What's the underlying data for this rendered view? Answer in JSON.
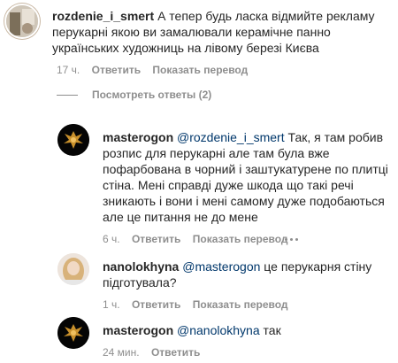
{
  "comments": {
    "top": {
      "username": "rozdenie_i_smert",
      "text": "А тепер будь ласка відмийте рекламу перукарні якою ви замалювали керамічне панно українських художниць на лівому березі Києва",
      "time": "17 ч.",
      "reply_label": "Ответить",
      "translate_label": "Показать перевод"
    },
    "view_replies_label": "Посмотреть ответы (2)",
    "replies": [
      {
        "username": "masterogon",
        "mention": "@rozdenie_i_smert",
        "text": "Так, я там робив розпис для перукарні але там була вже пофарбована в чорний і заштукатурене по плитці стіна. Мені справді дуже шкода що такі речі зникають і вони і мені самому дуже подобаються але це питання не до мене",
        "time": "6 ч.",
        "reply_label": "Ответить",
        "translate_label": "Показать перевод"
      },
      {
        "username": "nanolokhyna",
        "mention": "@masterogon",
        "text": "це перукарня стіну підготувала?",
        "time": "1 ч.",
        "reply_label": "Ответить",
        "translate_label": "Показать перевод"
      },
      {
        "username": "masterogon",
        "mention": "@nanolokhyna",
        "text": "так",
        "time": "24 мин.",
        "reply_label": "Ответить"
      }
    ]
  },
  "colors": {
    "text": "#262626",
    "secondary": "#8e8e8e",
    "mention": "#00376b"
  }
}
